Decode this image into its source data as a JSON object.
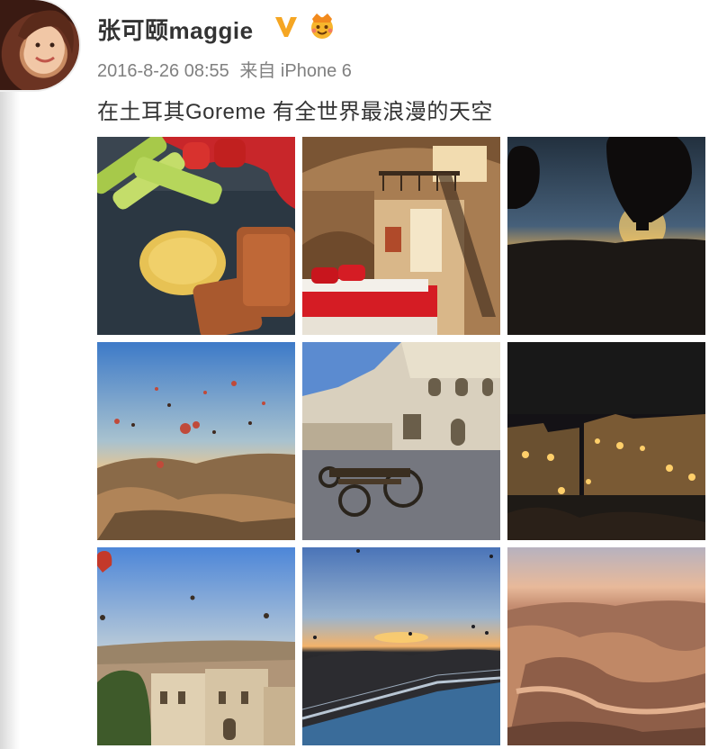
{
  "post": {
    "username": "张可颐maggie",
    "timestamp": "2016-8-26 08:55",
    "source": "来自 iPhone 6",
    "text": "在土耳其Goreme 有全世界最浪漫的天空",
    "verified_color": "#f5a623"
  },
  "photos": [
    {
      "id": "food",
      "subject": "vegetables and desserts on a plate"
    },
    {
      "id": "hotel-room",
      "subject": "cave hotel bedroom with red bed"
    },
    {
      "id": "balloon-sunrise",
      "subject": "balloon silhouettes at sunrise"
    },
    {
      "id": "balloons-valley",
      "subject": "hot air balloons over valley"
    },
    {
      "id": "courtyard-cart",
      "subject": "stone courtyard with wooden cart"
    },
    {
      "id": "hotel-night",
      "subject": "cave hotel lit at night"
    },
    {
      "id": "town-balloons",
      "subject": "town view with balloons"
    },
    {
      "id": "pool-sunrise",
      "subject": "infinity pool at sunrise"
    },
    {
      "id": "valley-aerial",
      "subject": "aerial view of rocky valley"
    }
  ]
}
